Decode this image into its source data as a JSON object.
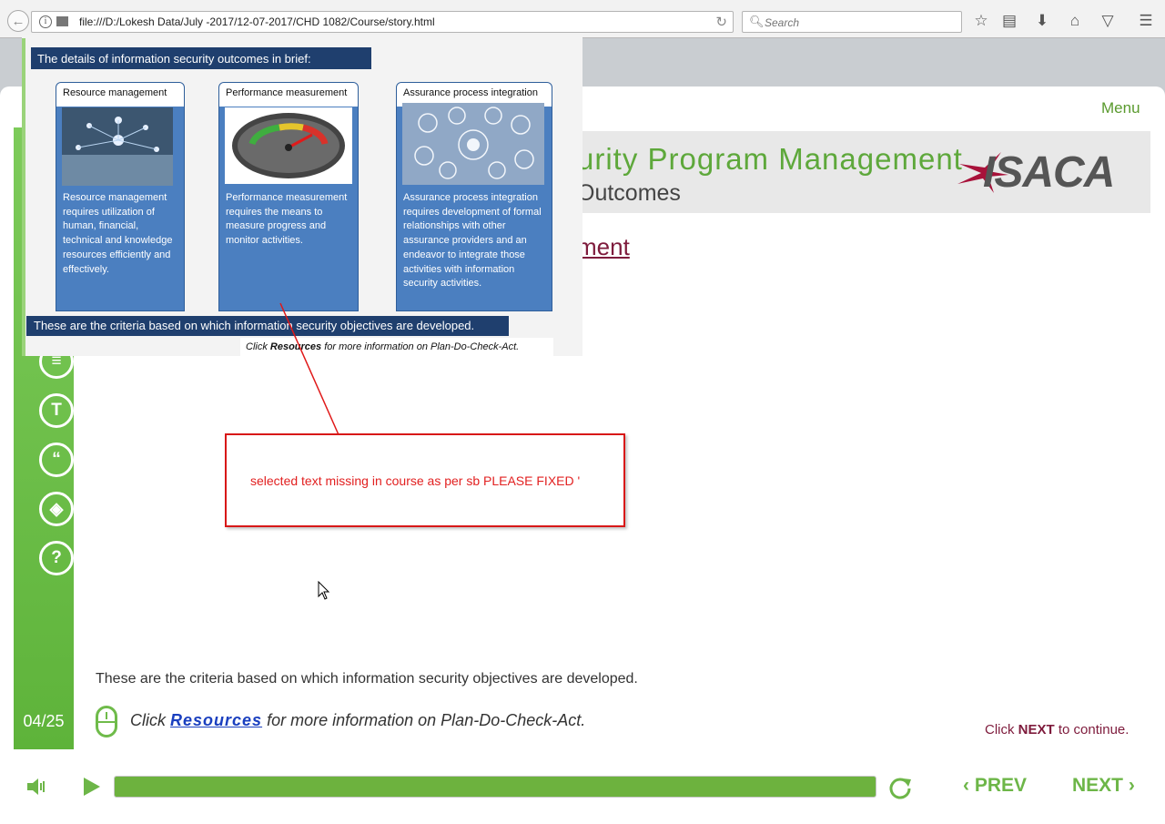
{
  "browser": {
    "url": "file:///D:/Lokesh Data/July -2017/12-07-2017/CHD 1082/Course/story.html",
    "search_placeholder": "Search"
  },
  "course": {
    "menu_label": "Menu",
    "title": "urity Program Management",
    "subtitle": "Outcomes",
    "logo_text": "ISACA",
    "section_heading": "ment",
    "slide_counter": "04/25",
    "criteria_text": "These are the criteria based on which information security objectives are developed.",
    "resources_prefix": "Click",
    "resources_link": "Resources",
    "resources_suffix": "for more information on Plan-Do-Check-Act.",
    "next_hint_prefix": "Click",
    "next_hint_bold": "NEXT",
    "next_hint_suffix": "to continue.",
    "prev_label": "PREV",
    "next_label": "NEXT",
    "progress_fraction": 1.0,
    "accent_color": "#6db23e",
    "title_color": "#7e1b3c"
  },
  "overlay": {
    "heading": "The details of information security outcomes in brief:",
    "cards": [
      {
        "title": "Resource management",
        "text": "Resource management requires utilization of human, financial, technical and knowledge resources efficiently and effectively."
      },
      {
        "title": "Performance measurement",
        "text": "Performance measurement requires the means to measure progress and monitor activities."
      },
      {
        "title": "Assurance process integration",
        "text": "Assurance process integration requires development of formal relationships with other assurance providers and an endeavor to integrate those activities with information security activities."
      }
    ],
    "criteria": "These are the criteria based on which information security objectives are developed.",
    "resources_prefix": "Click",
    "resources_bold": "Resources",
    "resources_suffix": "for more information on Plan-Do-Check-Act."
  },
  "annotation": {
    "text": "selected text missing in course as per sb PLEASE FIXED '"
  }
}
